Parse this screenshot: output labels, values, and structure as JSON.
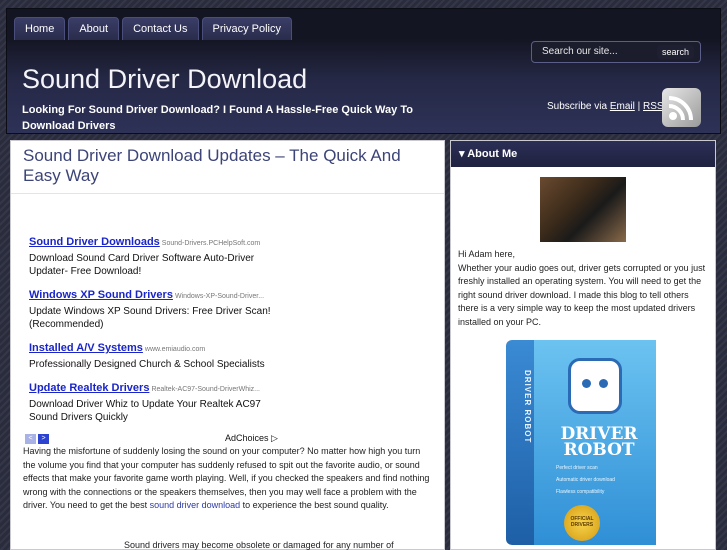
{
  "nav": {
    "items": [
      "Home",
      "About",
      "Contact Us",
      "Privacy Policy"
    ]
  },
  "search": {
    "placeholder": "Search our site...",
    "button_label": "search"
  },
  "header": {
    "title": "Sound Driver Download",
    "tagline": "Looking For Sound Driver Download? I Found A Hassle-Free Quick Way To Download Drivers",
    "subscribe_prefix": "Subscribe via",
    "email_link": "Email",
    "separator": "|",
    "rss_link": "RSS"
  },
  "post": {
    "title": "Sound Driver Download Updates – The Quick And Easy Way",
    "ads": [
      {
        "title": "Sound Driver Downloads",
        "url": "Sound-Drivers.PCHelpSoft.com",
        "desc": "Download Sound Card Driver Software Auto-Driver Updater- Free Download!"
      },
      {
        "title": "Windows XP Sound Drivers",
        "url": "Windows-XP-Sound-Driver...",
        "desc": "Update Windows XP Sound Drivers: Free Driver Scan! (Recommended)"
      },
      {
        "title": "Installed A/V Systems",
        "url": "www.emiaudio.com",
        "desc": "Professionally Designed Church & School Specialists"
      },
      {
        "title": "Update Realtek Drivers",
        "url": "Realtek-AC97-Sound-DriverWhiz...",
        "desc": "Download Driver Whiz to Update Your Realtek AC97 Sound Drivers Quickly"
      }
    ],
    "ad_prev": "<",
    "ad_next": ">",
    "adchoices": "AdChoices ▷",
    "body_before_link": "Having the misfortune of suddenly losing the sound on your computer? No matter how high you turn the volume you find that your computer has suddenly refused to spit out the favorite audio, or sound effects that make your favorite game worth playing. Well, if you checked the speakers and find nothing wrong with the connections or the speakers themselves, then you may well face a problem with the driver. You need to get the best ",
    "body_link": "sound driver download",
    "body_after_link": " to experience the best sound quality.",
    "body_partial": "Sound drivers may become obsolete or damaged for any number of"
  },
  "sidebar": {
    "header": "About Me",
    "header_arrow": "▾",
    "text": "Hi Adam here,\nWhether your audio goes out, driver gets corrupted or you just freshly installed an operating system. You will need to get the right sound driver download. I made this blog to tell others there is a very simple way to keep the most updated drivers installed on your PC.",
    "box": {
      "side_text": "DRIVER ROBOT",
      "title": "DRIVER ROBOT",
      "features": [
        "Perfect driver scan",
        "Automatic driver download",
        "Flawless compatibility"
      ],
      "badge": "OFFICIAL DRIVERS"
    }
  },
  "colors": {
    "accent": "#3c4478",
    "link": "#1a25c8",
    "header_bg": "#1f2140"
  }
}
